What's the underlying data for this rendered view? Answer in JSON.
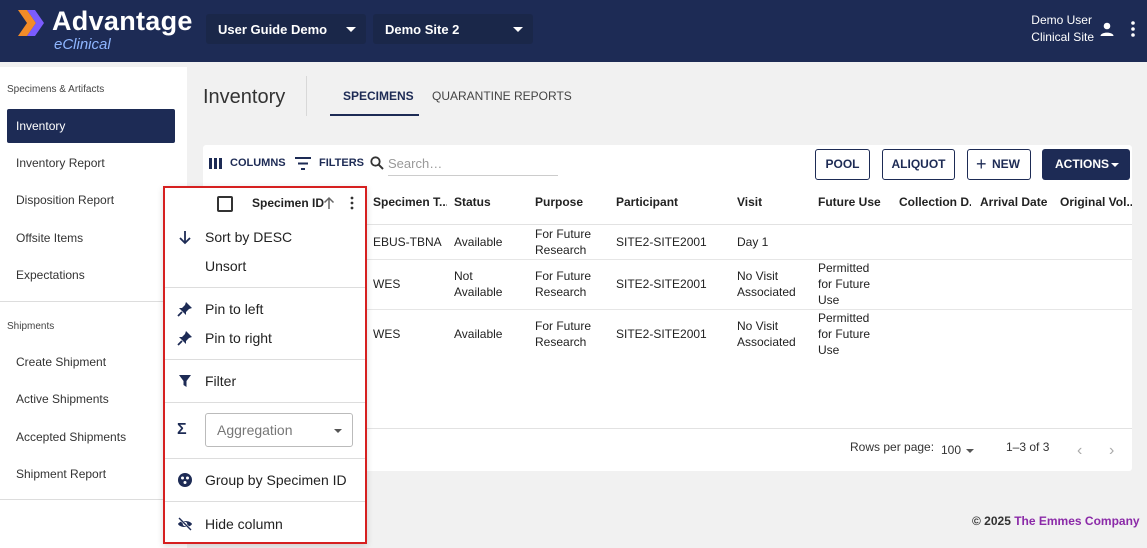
{
  "header": {
    "logo_main": "Advantage",
    "logo_sub": "eClinical",
    "study_select": "User Guide Demo",
    "site_select": "Demo Site 2",
    "user_name": "Demo User",
    "user_site": "Clinical Site",
    "icons": [
      "logo-chevron-icon",
      "user-icon",
      "more-vert-icon"
    ]
  },
  "sidebar": {
    "section1": "Specimens & Artifacts",
    "items1": [
      "Inventory",
      "Inventory Report",
      "Disposition Report",
      "Offsite Items",
      "Expectations"
    ],
    "section2": "Shipments",
    "items2": [
      "Create Shipment",
      "Active Shipments",
      "Accepted Shipments",
      "Shipment Report"
    ],
    "active_item": "Inventory"
  },
  "main": {
    "title": "Inventory",
    "tabs": [
      "SPECIMENS",
      "QUARANTINE REPORTS"
    ],
    "active_tab": "SPECIMENS"
  },
  "toolbar": {
    "columns_label": "COLUMNS",
    "filters_label": "FILTERS",
    "search_placeholder": "Search…",
    "pool_label": "POOL",
    "aliquot_label": "ALIQUOT",
    "new_label": "NEW",
    "actions_label": "ACTIONS"
  },
  "grid": {
    "headers": [
      "Specimen ID",
      "Specimen T...",
      "Status",
      "Purpose",
      "Participant",
      "Visit",
      "Future Use",
      "Collection D...",
      "Arrival Date",
      "Original Vol..."
    ],
    "rows": [
      {
        "type": "EBUS-TBNA",
        "status": "Available",
        "purpose": "For Future Research",
        "participant": "SITE2-SITE2001",
        "visit": "Day 1",
        "future_use": ""
      },
      {
        "type": "WES",
        "status": "Not Available",
        "purpose": "For Future Research",
        "participant": "SITE2-SITE2001",
        "visit": "No Visit Associated",
        "future_use": "Permitted for Future Use"
      },
      {
        "type": "WES",
        "status": "Available",
        "purpose": "For Future Research",
        "participant": "SITE2-SITE2001",
        "visit": "No Visit Associated",
        "future_use": "Permitted for Future Use"
      }
    ],
    "rows_per_page_label": "Rows per page:",
    "rows_per_page": "100",
    "range": "1–3 of 3"
  },
  "column_menu": {
    "sort_desc": "Sort by DESC",
    "unsort": "Unsort",
    "pin_left": "Pin to left",
    "pin_right": "Pin to right",
    "filter": "Filter",
    "aggregation_placeholder": "Aggregation",
    "group_by": "Group by Specimen ID",
    "hide_column": "Hide column"
  },
  "footer": {
    "copyright": "© 2025",
    "company": "The Emmes Company"
  },
  "colors": {
    "navy": "#1d2b55",
    "highlight_border": "#d62020",
    "company_link": "#8b2aa8"
  }
}
